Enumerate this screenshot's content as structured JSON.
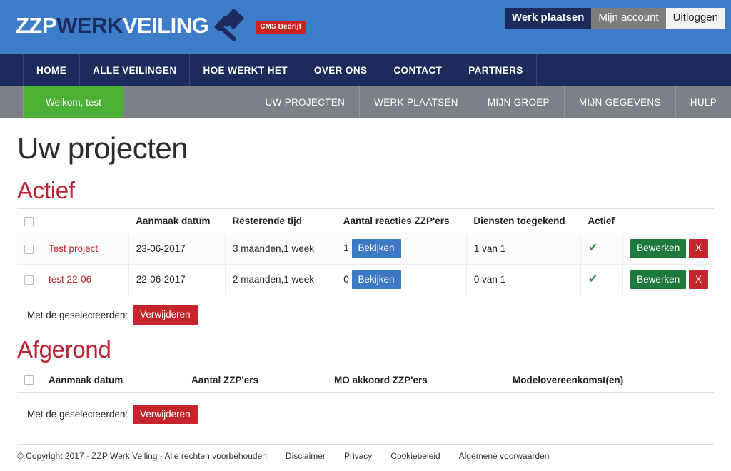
{
  "brand": {
    "logo_part1": "ZZP",
    "logo_part2": "WERK",
    "logo_part3": "VEILING",
    "badge": "CMS Bedrijf",
    "gavel_icon": "gavel-icon",
    "header_bg": "#3d7cc9",
    "navy": "#1d2a5c",
    "accent_red": "#bf2131",
    "accent_green": "#4caf36"
  },
  "account_links": [
    {
      "label": "Werk plaatsen",
      "style": "dark"
    },
    {
      "label": "Mijn account",
      "style": "grey"
    },
    {
      "label": "Uitloggen",
      "style": "light"
    }
  ],
  "main_nav": [
    {
      "label": "HOME"
    },
    {
      "label": "ALLE VEILINGEN"
    },
    {
      "label": "HOE WERKT HET"
    },
    {
      "label": "OVER ONS"
    },
    {
      "label": "CONTACT"
    },
    {
      "label": "PARTNERS"
    }
  ],
  "sub_nav": {
    "welcome": "Welkom, test",
    "items": [
      {
        "label": "UW PROJECTEN"
      },
      {
        "label": "WERK PLAATSEN"
      },
      {
        "label": "MIJN GROEP"
      },
      {
        "label": "MIJN GEGEVENS"
      },
      {
        "label": "HULP"
      }
    ]
  },
  "page": {
    "title": "Uw projecten"
  },
  "actief": {
    "heading": "Actief",
    "columns": [
      "",
      "",
      "Aanmaak datum",
      "Resterende tijd",
      "Aantal reacties ZZP'ers",
      "Diensten toegekend",
      "Actief",
      ""
    ],
    "rows": [
      {
        "name": "Test project",
        "aanmaak_datum": "23-06-2017",
        "resterende_tijd": "3 maanden,1 week",
        "reacties_count": "1",
        "reacties_button": "Bekijken",
        "diensten": "1 van 1",
        "diensten_state": "green",
        "actief_icon": "check-icon",
        "edit_label": "Bewerken",
        "delete_label": "X"
      },
      {
        "name": "test 22-06",
        "aanmaak_datum": "22-06-2017",
        "resterende_tijd": "2 maanden,1 week",
        "reacties_count": "0",
        "reacties_button": "Bekijken",
        "diensten": "0 van 1",
        "diensten_state": "red",
        "actief_icon": "check-icon",
        "edit_label": "Bewerken",
        "delete_label": "X"
      }
    ],
    "bulk_label": "Met de geselecteerden:",
    "bulk_button": "Verwijderen"
  },
  "afgerond": {
    "heading": "Afgerond",
    "columns": [
      "",
      "Aanmaak datum",
      "Aantal ZZP'ers",
      "MO akkoord ZZP'ers",
      "Modelovereenkomst(en)"
    ],
    "rows": [],
    "bulk_label": "Met de geselecteerden:",
    "bulk_button": "Verwijderen"
  },
  "footer": {
    "copyright": "© Copyright 2017 - ZZP Werk Veiling - Alle rechten voorbehouden",
    "links": [
      {
        "label": "Disclaimer"
      },
      {
        "label": "Privacy"
      },
      {
        "label": "Cookiebeleid"
      },
      {
        "label": "Algemene voorwaarden"
      }
    ]
  }
}
